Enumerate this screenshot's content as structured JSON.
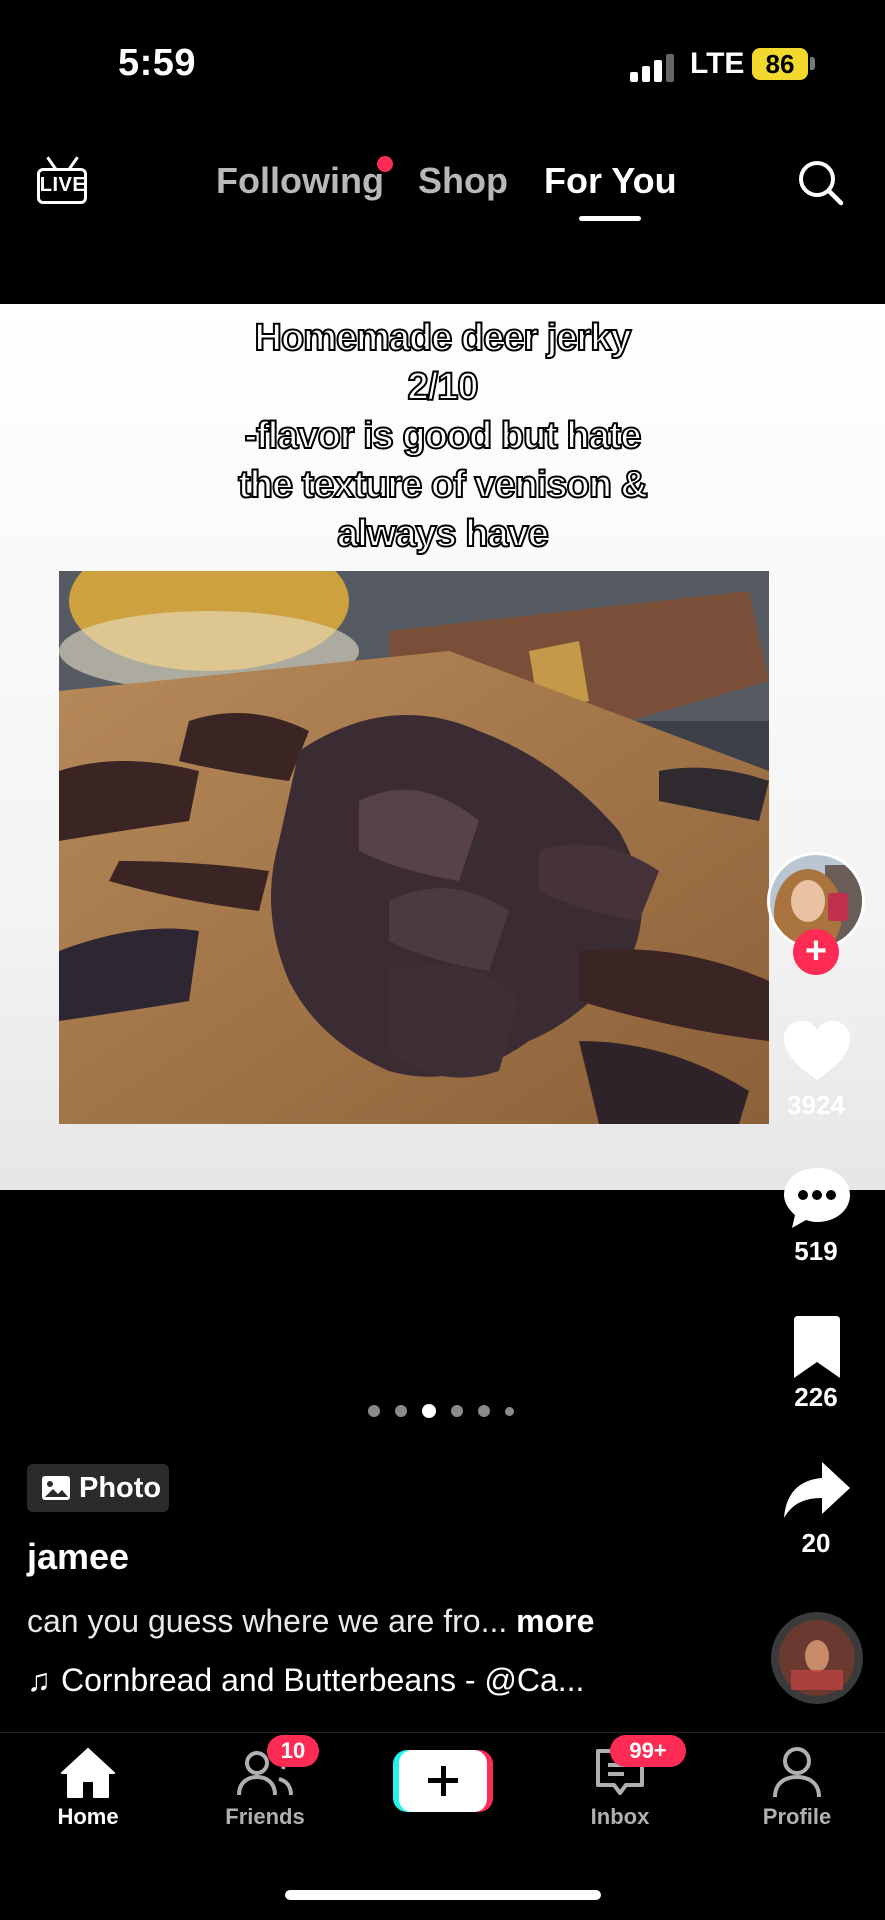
{
  "status_bar": {
    "time": "5:59",
    "network": "LTE",
    "battery": "86"
  },
  "top_nav": {
    "live_label": "LIVE",
    "tabs": [
      {
        "label": "Following",
        "has_dot": true
      },
      {
        "label": "Shop"
      },
      {
        "label": "For You",
        "active": true
      }
    ]
  },
  "post": {
    "caption_lines": [
      "Homemade deer jerky",
      "2/10",
      "-flavor is good but hate",
      "the texture of venison &",
      "always have"
    ],
    "carousel": {
      "total": 6,
      "active_index": 2
    },
    "type_label": "Photo",
    "username": "jamee",
    "description": "can you guess where we are fro...",
    "more_label": "more",
    "sound": "Cornbread and Butterbeans - @Ca..."
  },
  "actions": {
    "likes": "3924",
    "comments": "519",
    "saves": "226",
    "shares": "20"
  },
  "bottom_nav": {
    "items": [
      {
        "label": "Home",
        "active": true
      },
      {
        "label": "Friends",
        "badge": "10"
      },
      {
        "label": ""
      },
      {
        "label": "Inbox",
        "badge": "99+"
      },
      {
        "label": "Profile"
      }
    ]
  },
  "colors": {
    "accent": "#fe2c55",
    "cyan": "#25f4ee",
    "battery": "#f3d82d"
  }
}
